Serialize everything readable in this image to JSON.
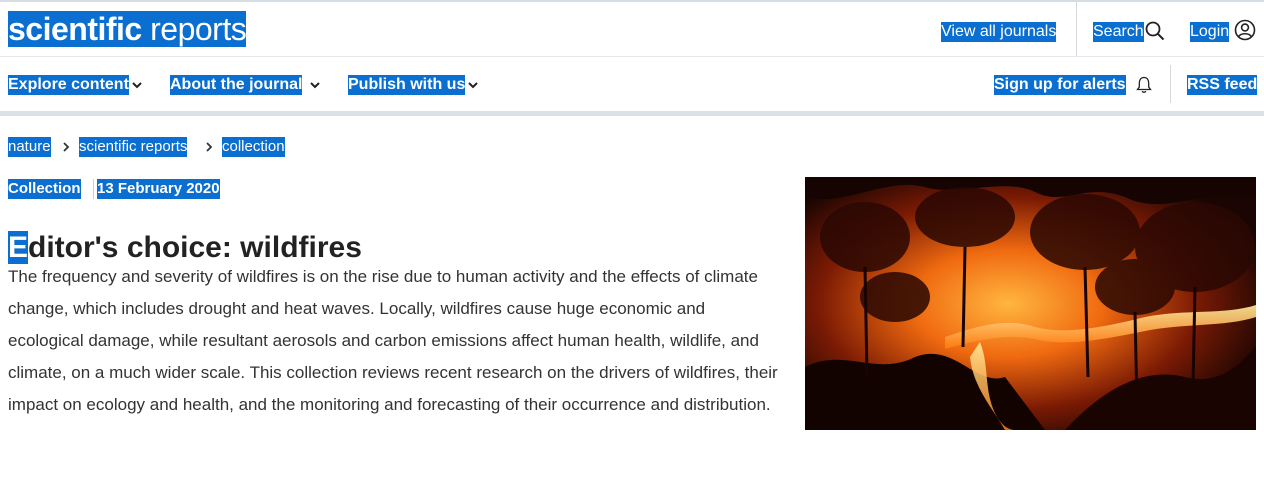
{
  "header": {
    "logo_bold": "scientific",
    "logo_light": "reports",
    "view_all_journals": "View all journals",
    "search": "Search",
    "login": "Login"
  },
  "nav": {
    "explore": "Explore content",
    "about": "About the journal",
    "publish": "Publish with us",
    "alerts": "Sign up for alerts",
    "rss": "RSS feed"
  },
  "breadcrumb": [
    "nature",
    "scientific reports",
    "collection"
  ],
  "article": {
    "type": "Collection",
    "date": "13 February 2020",
    "title_first_letter": "E",
    "title_rest": "ditor's choice: wildfires",
    "description": "The frequency and severity of wildfires is on the rise due to human activity and the effects of climate change, which includes drought and heat waves. Locally, wildfires cause huge economic and ecological damage, while resultant aerosols and carbon emissions affect human health, wildlife, and climate, on a much wider scale. This collection reviews recent research on the drivers of wildfires, their impact on ecology and health, and the monitoring and forecasting of their occurrence and distribution."
  },
  "colors": {
    "selection": "#0a6fd0",
    "logo": "#1d4a84"
  },
  "icons": {
    "search": "search-icon",
    "login": "user-circle-icon",
    "alerts": "bell-icon",
    "nav_chevron": "chevron-down-icon",
    "breadcrumb_chevron": "chevron-right-icon"
  }
}
